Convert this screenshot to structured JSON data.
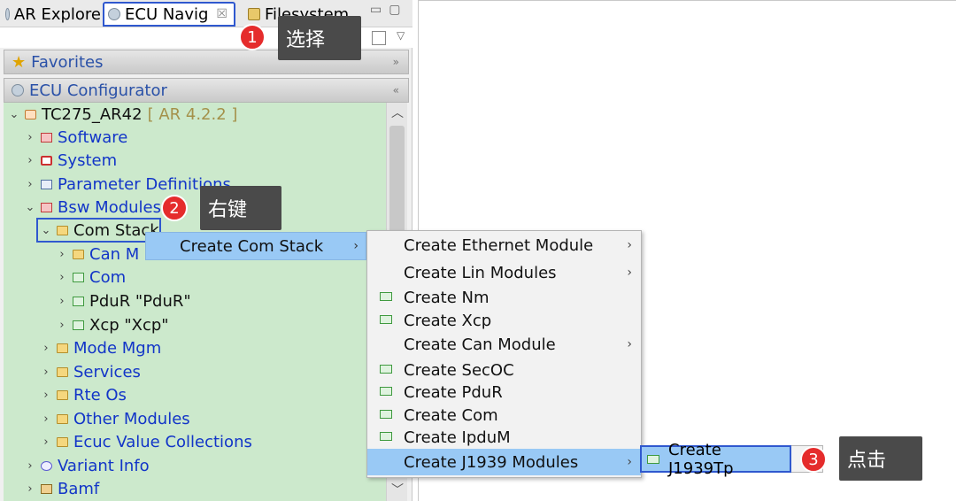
{
  "tabs": [
    {
      "label": "AR Explore"
    },
    {
      "label": "ECU Navig"
    },
    {
      "label": "Filesystem"
    }
  ],
  "sections": {
    "favorites": "Favorites",
    "ecu_configurator": "ECU Configurator"
  },
  "tree": {
    "root": "TC275_AR42",
    "root_version": "[ AR 4.2.2 ]",
    "software": "Software",
    "system": "System",
    "param_defs": "Parameter Definitions",
    "bsw": "Bsw Modules",
    "com_stack": "Com Stack",
    "can_m": "Can M",
    "com": "Com",
    "pdur": "PduR \"PduR\"",
    "xcp": "Xcp \"Xcp\"",
    "mode_mgm": "Mode Mgm",
    "services": "Services",
    "rte_os": "Rte Os",
    "other_modules": "Other Modules",
    "ecuc": "Ecuc Value Collections",
    "variant_info": "Variant Info",
    "bamf": "Bamf"
  },
  "context_menu": {
    "create_com_stack": "Create Com Stack"
  },
  "submenu": [
    {
      "label": "Create Ethernet Module",
      "has_sub": true,
      "icon": false
    },
    {
      "label": "Create Lin Modules",
      "has_sub": true,
      "icon": false
    },
    {
      "label": "Create Nm",
      "has_sub": false,
      "icon": true
    },
    {
      "label": "Create Xcp",
      "has_sub": false,
      "icon": true
    },
    {
      "label": "Create Can Module",
      "has_sub": true,
      "icon": false
    },
    {
      "label": "Create SecOC",
      "has_sub": false,
      "icon": true
    },
    {
      "label": "Create PduR",
      "has_sub": false,
      "icon": true
    },
    {
      "label": "Create Com",
      "has_sub": false,
      "icon": true
    },
    {
      "label": "Create IpduM",
      "has_sub": false,
      "icon": true
    },
    {
      "label": "Create J1939 Modules",
      "has_sub": true,
      "icon": false
    }
  ],
  "submenu2": {
    "create_j1939tp": "Create J1939Tp"
  },
  "annotations": [
    {
      "num": "1",
      "text": "选择"
    },
    {
      "num": "2",
      "text": "右键"
    },
    {
      "num": "3",
      "text": "点击"
    }
  ]
}
